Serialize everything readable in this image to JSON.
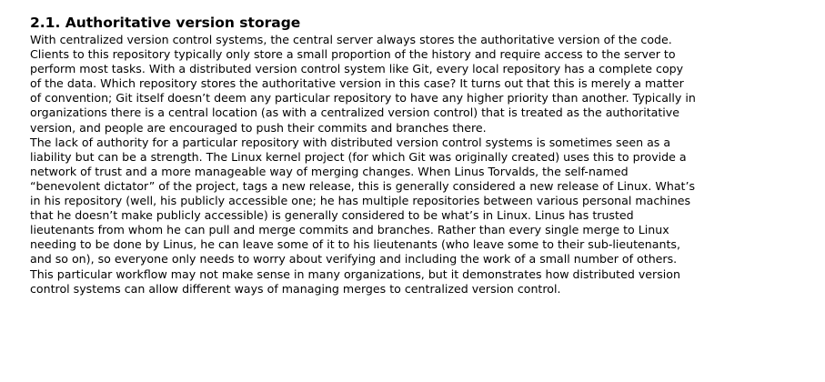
{
  "heading": "2.1. Authoritative version storage",
  "paragraphs": [
    {
      "lines": [
        "With centralized version control systems, the central server always stores the authoritative version of the code.",
        "Clients to this repository typically only store a small proportion of the history and require access to the server to",
        "perform most tasks. With a distributed version control system like Git, every local repository has a complete copy",
        "of the data. Which repository stores the authoritative version in this case? It turns out that this is merely a matter",
        "of convention; Git itself doesn’t deem any particular repository to have any higher priority than another. Typically in",
        "organizations there is a central location (as with a centralized version control) that is treated as the authoritative",
        "version, and people are encouraged to push their commits and branches there."
      ]
    },
    {
      "lines": [
        "The lack of authority for a particular repository with distributed version control systems is sometimes seen as a",
        "liability but can be a strength. The Linux kernel project (for which Git was originally created) uses this to provide a",
        "network of trust and a more manageable way of merging changes. When Linus Torvalds, the self-named",
        "“benevolent dictator” of the project, tags a new release, this is generally considered a new release of Linux. What’s",
        "in his repository (well, his publicly accessible one; he has multiple repositories between various personal machines",
        "that he doesn’t make publicly accessible) is generally considered to be what’s in Linux. Linus has trusted",
        "lieutenants from whom he can pull and merge commits and branches. Rather than every single merge to Linux",
        "needing to be done by Linus, he can leave some of it to his lieutenants (who leave some to their sub-lieutenants,",
        "and so on), so everyone only needs to worry about verifying and including the work of a small number of others.",
        "This particular workflow may not make sense in many organizations, but it demonstrates how distributed version",
        "control systems can allow different ways of managing merges to centralized version control."
      ]
    }
  ]
}
